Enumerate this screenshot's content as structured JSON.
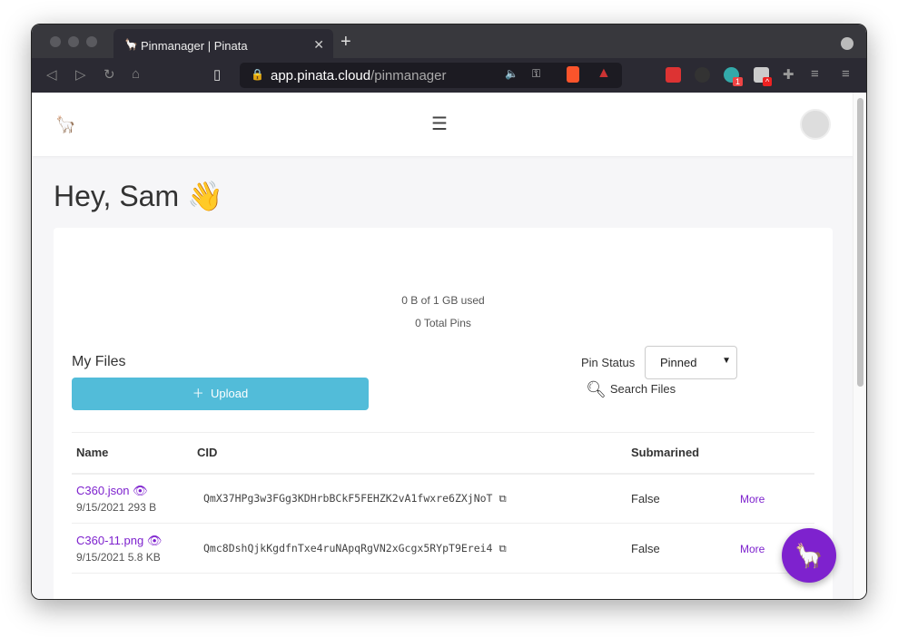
{
  "browser": {
    "tab_title": "Pinmanager | Pinata",
    "url_host": "app.pinata.cloud",
    "url_path": "/pinmanager",
    "ext_badges": [
      "1",
      "^"
    ]
  },
  "greeting": "Hey, Sam 👋",
  "usage": {
    "storage": "0 B of 1 GB used",
    "pins": "0 Total Pins"
  },
  "files": {
    "title": "My Files",
    "upload_label": "Upload",
    "pin_status_label": "Pin Status",
    "pin_status_value": "Pinned",
    "search_label": "Search Files",
    "columns": [
      "Name",
      "CID",
      "Submarined"
    ],
    "rows": [
      {
        "name": "C360.json",
        "date": "9/15/2021",
        "size": "293 B",
        "cid": "QmX37HPg3w3FGg3KDHrbBCkF5FEHZK2vA1fwxre6ZXjNoT",
        "submarined": "False",
        "more": "More"
      },
      {
        "name": "C360-11.png",
        "date": "9/15/2021",
        "size": "5.8 KB",
        "cid": "Qmc8DshQjkKgdfnTxe4ruNApqRgVN2xGcgx5RYpT9Erei4",
        "submarined": "False",
        "more": "More"
      }
    ]
  },
  "colors": {
    "accent": "#7e22ce",
    "upload": "#52bcd9"
  }
}
